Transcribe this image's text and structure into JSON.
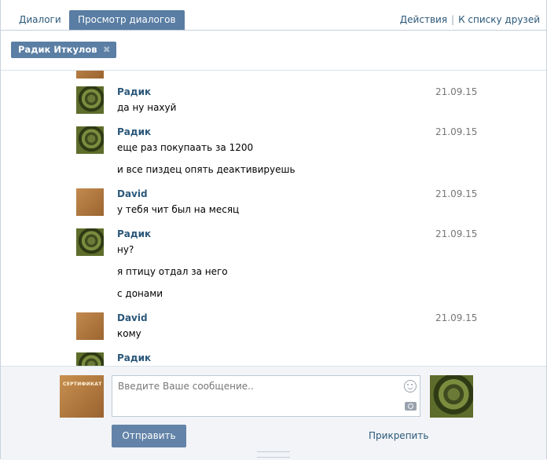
{
  "tabs": {
    "dialogs": "Диалоги",
    "view": "Просмотр диалогов"
  },
  "actions": {
    "actions": "Действия",
    "sep": "|",
    "friends": "К списку друзей"
  },
  "filter": {
    "name": "Радик Иткулов",
    "close": "✖"
  },
  "messages": [
    {
      "author": "Радик",
      "avatar": "gator",
      "date": "21.09.15",
      "lines": [
        "да ну нахуй"
      ]
    },
    {
      "author": "Радик",
      "avatar": "gator",
      "date": "21.09.15",
      "lines": [
        "еще раз покупаать за 1200",
        "и все пиздец опять деактивируешь"
      ]
    },
    {
      "author": "David",
      "avatar": "cert",
      "date": "21.09.15",
      "lines": [
        "у тебя чит был на месяц"
      ]
    },
    {
      "author": "Радик",
      "avatar": "gator",
      "date": "21.09.15",
      "lines": [
        "ну?",
        "я птицу отдал за него",
        "с донами"
      ]
    },
    {
      "author": "David",
      "avatar": "cert",
      "date": "21.09.15",
      "lines": [
        "кому"
      ]
    },
    {
      "author": "Радик",
      "avatar": "gator",
      "date": "",
      "lines": []
    }
  ],
  "composer": {
    "placeholder": "Введите Ваше сообщение..",
    "send": "Отправить",
    "attach": "Прикрепить",
    "my_avatar_text": "СЕРТИФИКАТ"
  },
  "colors": {
    "link": "#2b587a",
    "accent": "#597da3",
    "button": "#6383a8"
  }
}
